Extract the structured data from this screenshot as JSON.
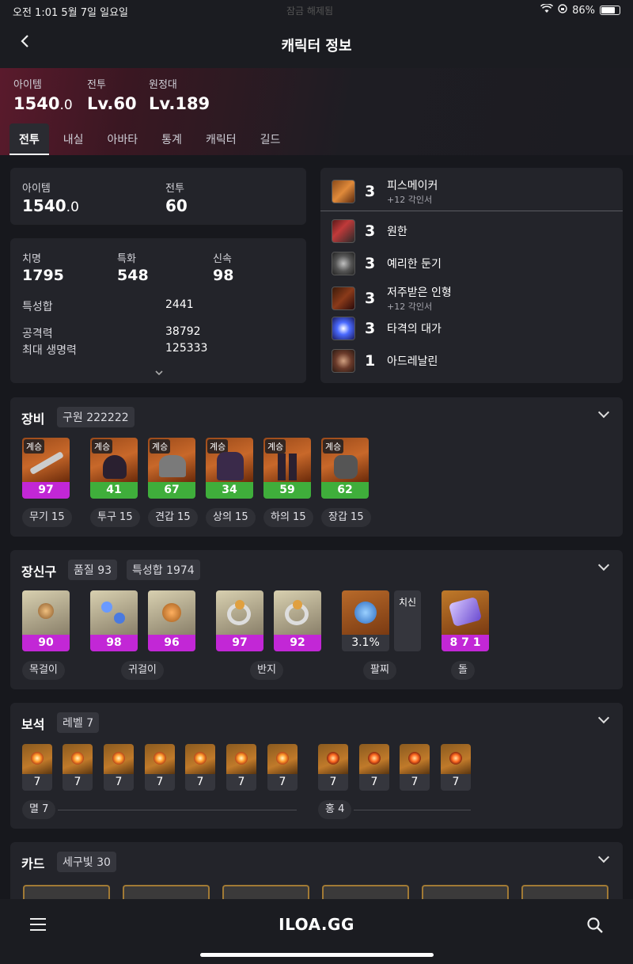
{
  "status": {
    "time": "오전 1:01  5월 7일 일요일",
    "lock_text": "잠금 해제됨",
    "battery": "86%",
    "battery_level": 0.86
  },
  "header": {
    "title": "캐릭터 정보"
  },
  "hero": {
    "stats": [
      {
        "label": "아이템",
        "value": "1540",
        "decimal": ".0"
      },
      {
        "label": "전투",
        "value": "Lv.60",
        "decimal": ""
      },
      {
        "label": "원정대",
        "value": "Lv.189",
        "decimal": ""
      }
    ],
    "tabs": [
      "전투",
      "내실",
      "아바타",
      "통계",
      "캐릭터",
      "길드"
    ]
  },
  "summary": {
    "item_label": "아이템",
    "item_value": "1540",
    "item_decimal": ".0",
    "combat_label": "전투",
    "combat_value": "60"
  },
  "stats": {
    "crit_label": "치명",
    "crit": "1795",
    "spec_label": "특화",
    "spec": "548",
    "swift_label": "신속",
    "swift": "98",
    "total_label": "특성합",
    "total": "2441",
    "atk_label": "공격력",
    "atk": "38792",
    "hp_label": "최대 생명력",
    "hp": "125333"
  },
  "engravings": [
    {
      "level": "3",
      "name": "피스메이커",
      "sub": "+12 각인서"
    },
    {
      "level": "3",
      "name": "원한",
      "sub": ""
    },
    {
      "level": "3",
      "name": "예리한 둔기",
      "sub": ""
    },
    {
      "level": "3",
      "name": "저주받은 인형",
      "sub": "+12 각인서"
    },
    {
      "level": "3",
      "name": "타격의 대가",
      "sub": ""
    },
    {
      "level": "1",
      "name": "아드레날린",
      "sub": ""
    }
  ],
  "equipment": {
    "title": "장비",
    "chip": "구원 222222",
    "badge": "계승",
    "items": [
      {
        "quality": "97",
        "label": "무기 15",
        "qcolor": "#c227d6"
      },
      {
        "quality": "41",
        "label": "투구 15",
        "qcolor": "#3fae3b"
      },
      {
        "quality": "67",
        "label": "견갑 15",
        "qcolor": "#3fae3b"
      },
      {
        "quality": "34",
        "label": "상의 15",
        "qcolor": "#3fae3b"
      },
      {
        "quality": "59",
        "label": "하의 15",
        "qcolor": "#3fae3b"
      },
      {
        "quality": "62",
        "label": "장갑 15",
        "qcolor": "#3fae3b"
      }
    ]
  },
  "accessories": {
    "title": "장신구",
    "chip1": "품질 93",
    "chip2": "특성합 1974",
    "items": [
      {
        "quality": "90"
      },
      {
        "quality": "98"
      },
      {
        "quality": "96"
      },
      {
        "quality": "97"
      },
      {
        "quality": "92"
      }
    ],
    "bracelet_value": "3.1%",
    "bracelet_stat": "치신",
    "stone_value": "8 7 1",
    "labels": [
      "목걸이",
      "귀걸이",
      "반지",
      "팔찌",
      "돌"
    ]
  },
  "gems": {
    "title": "보석",
    "chip": "레벨 7",
    "levels_left": [
      "7",
      "7",
      "7",
      "7",
      "7",
      "7",
      "7"
    ],
    "levels_right": [
      "7",
      "7",
      "7",
      "7"
    ],
    "left_label": "멸 7",
    "right_label": "홍 4"
  },
  "cards": {
    "title": "카드",
    "chip": "세구빛 30"
  },
  "bottom": {
    "logo": "ILOA.GG"
  },
  "colors": {
    "legendary_quality": "#c227d6",
    "good_quality": "#3fae3b",
    "background": "#17181d",
    "card": "#23242a"
  }
}
